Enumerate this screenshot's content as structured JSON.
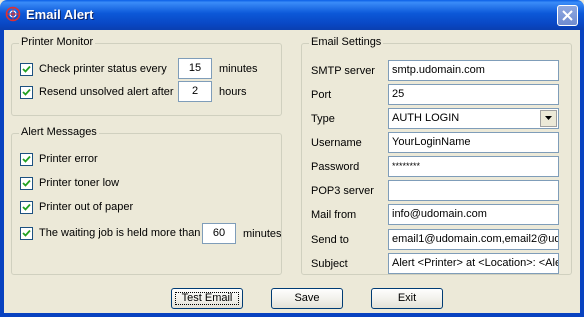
{
  "window": {
    "title": "Email Alert"
  },
  "printer_monitor": {
    "title": "Printer Monitor",
    "check_status": {
      "label": "Check printer status every",
      "checked": true,
      "value": "15",
      "unit": "minutes"
    },
    "resend_alert": {
      "label": "Resend unsolved alert after",
      "checked": true,
      "value": "2",
      "unit": "hours"
    }
  },
  "alert_messages": {
    "title": "Alert Messages",
    "printer_error": {
      "label": "Printer error",
      "checked": true
    },
    "toner_low": {
      "label": "Printer toner low",
      "checked": true
    },
    "out_of_paper": {
      "label": "Printer out of paper",
      "checked": true
    },
    "waiting_job": {
      "label": "The waiting job is held more than",
      "checked": true,
      "value": "60",
      "unit": "minutes"
    }
  },
  "email_settings": {
    "title": "Email Settings",
    "smtp_server": {
      "label": "SMTP server",
      "value": "smtp.udomain.com"
    },
    "port": {
      "label": "Port",
      "value": "25"
    },
    "type": {
      "label": "Type",
      "value": "AUTH LOGIN"
    },
    "username": {
      "label": "Username",
      "value": "YourLoginName"
    },
    "password": {
      "label": "Password",
      "value": "********"
    },
    "pop3_server": {
      "label": "POP3 server",
      "value": ""
    },
    "mail_from": {
      "label": "Mail from",
      "value": "info@udomain.com"
    },
    "send_to": {
      "label": "Send to",
      "value": "email1@udomain.com,email2@udo"
    },
    "subject": {
      "label": "Subject",
      "value": "Alert <Printer> at <Location>: <Alert"
    }
  },
  "buttons": {
    "test_email": "Test Email",
    "save": "Save",
    "exit": "Exit"
  }
}
